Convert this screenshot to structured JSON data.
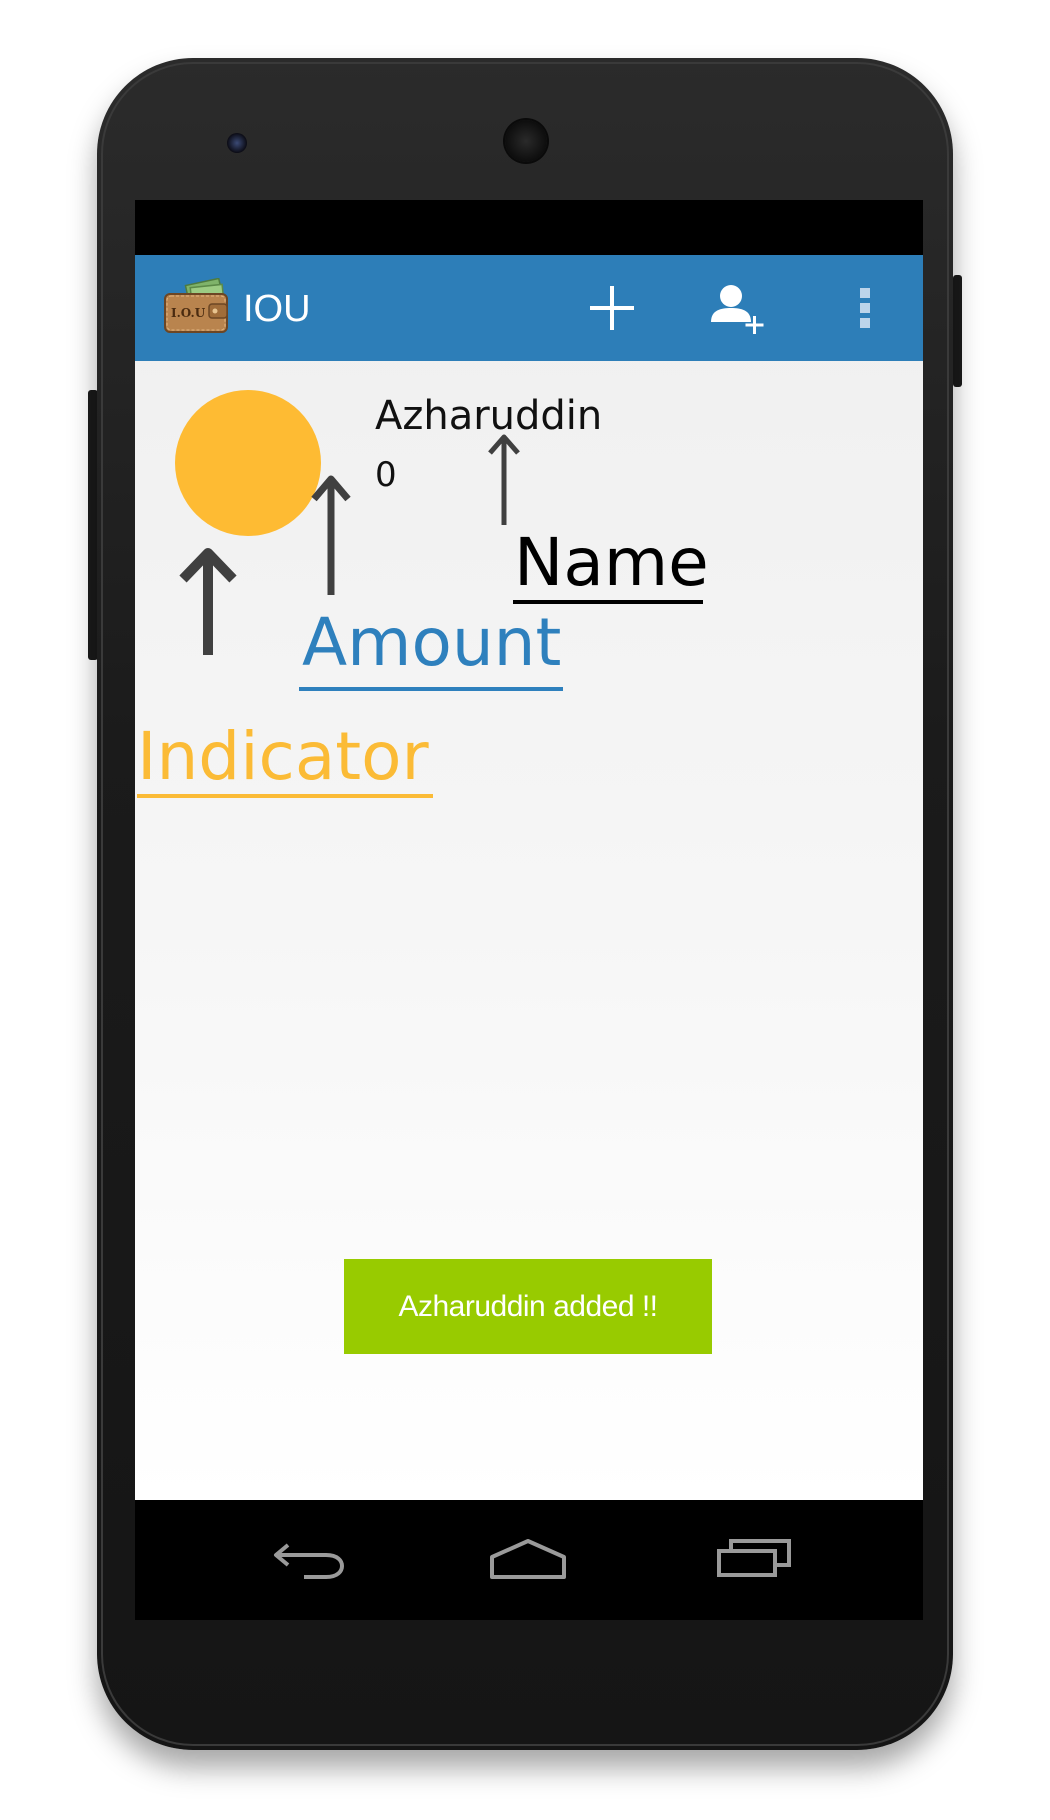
{
  "app": {
    "title": "IOU",
    "icon": "iou-wallet-icon",
    "icon_text": "I.O.U"
  },
  "action_bar": {
    "background": "#2d7eb8",
    "actions": [
      {
        "icon": "add-icon"
      },
      {
        "icon": "add-person-icon"
      },
      {
        "icon": "overflow-menu-icon"
      }
    ]
  },
  "entry": {
    "name": "Azharuddin",
    "amount": "0",
    "indicator_color": "#febb33"
  },
  "annotations": {
    "name_label": "Name",
    "amount_label": "Amount",
    "indicator_label": "Indicator",
    "name_color": "#000000",
    "amount_color": "#2e80bd",
    "indicator_color": "#fbbb36"
  },
  "toast": {
    "message": "Azharuddin added !!",
    "background": "#98cb00"
  },
  "navigation": {
    "buttons": [
      "back-icon",
      "home-icon",
      "recents-icon"
    ]
  }
}
